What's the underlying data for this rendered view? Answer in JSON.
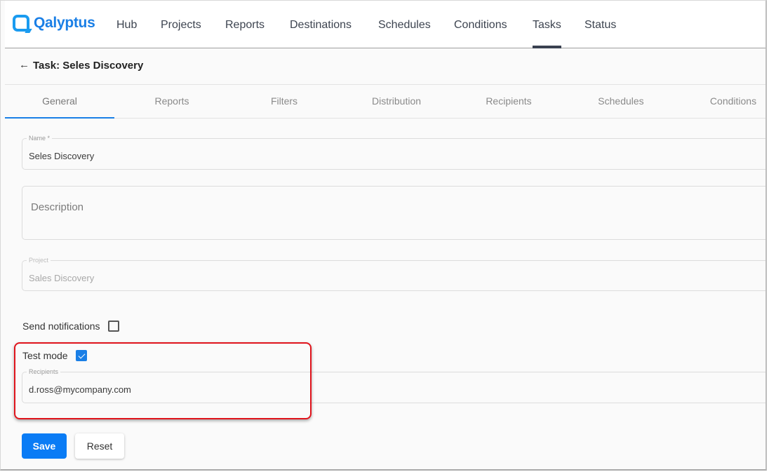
{
  "app": {
    "brand": "Qalyptus",
    "brand_color": "#1a7fe6",
    "accent_color": "#0a7cf5",
    "highlight_color": "#e0141c"
  },
  "nav": {
    "items": [
      {
        "label": "Hub",
        "active": false
      },
      {
        "label": "Projects",
        "active": false
      },
      {
        "label": "Reports",
        "active": false
      },
      {
        "label": "Destinations",
        "active": false
      },
      {
        "label": "Schedules",
        "active": false
      },
      {
        "label": "Conditions",
        "active": false
      },
      {
        "label": "Tasks",
        "active": true
      },
      {
        "label": "Status",
        "active": false
      }
    ]
  },
  "header": {
    "back_icon": "arrow-left-icon",
    "back_glyph": "←",
    "title": "Task: Seles Discovery"
  },
  "tabs": [
    {
      "label": "General",
      "active": true
    },
    {
      "label": "Reports",
      "active": false
    },
    {
      "label": "Filters",
      "active": false
    },
    {
      "label": "Distribution",
      "active": false
    },
    {
      "label": "Recipients",
      "active": false
    },
    {
      "label": "Schedules",
      "active": false
    },
    {
      "label": "Conditions",
      "active": false
    }
  ],
  "form": {
    "name": {
      "label": "Name *",
      "value": "Seles Discovery"
    },
    "description": {
      "placeholder": "Description",
      "value": ""
    },
    "project": {
      "label": "Project",
      "value": "Sales Discovery",
      "disabled": true
    },
    "send_notifications": {
      "label": "Send notifications",
      "checked": false
    },
    "test_mode": {
      "label": "Test mode",
      "checked": true
    },
    "recipients": {
      "label": "Recipients",
      "value": "d.ross@mycompany.com"
    }
  },
  "actions": {
    "save_label": "Save",
    "reset_label": "Reset"
  }
}
